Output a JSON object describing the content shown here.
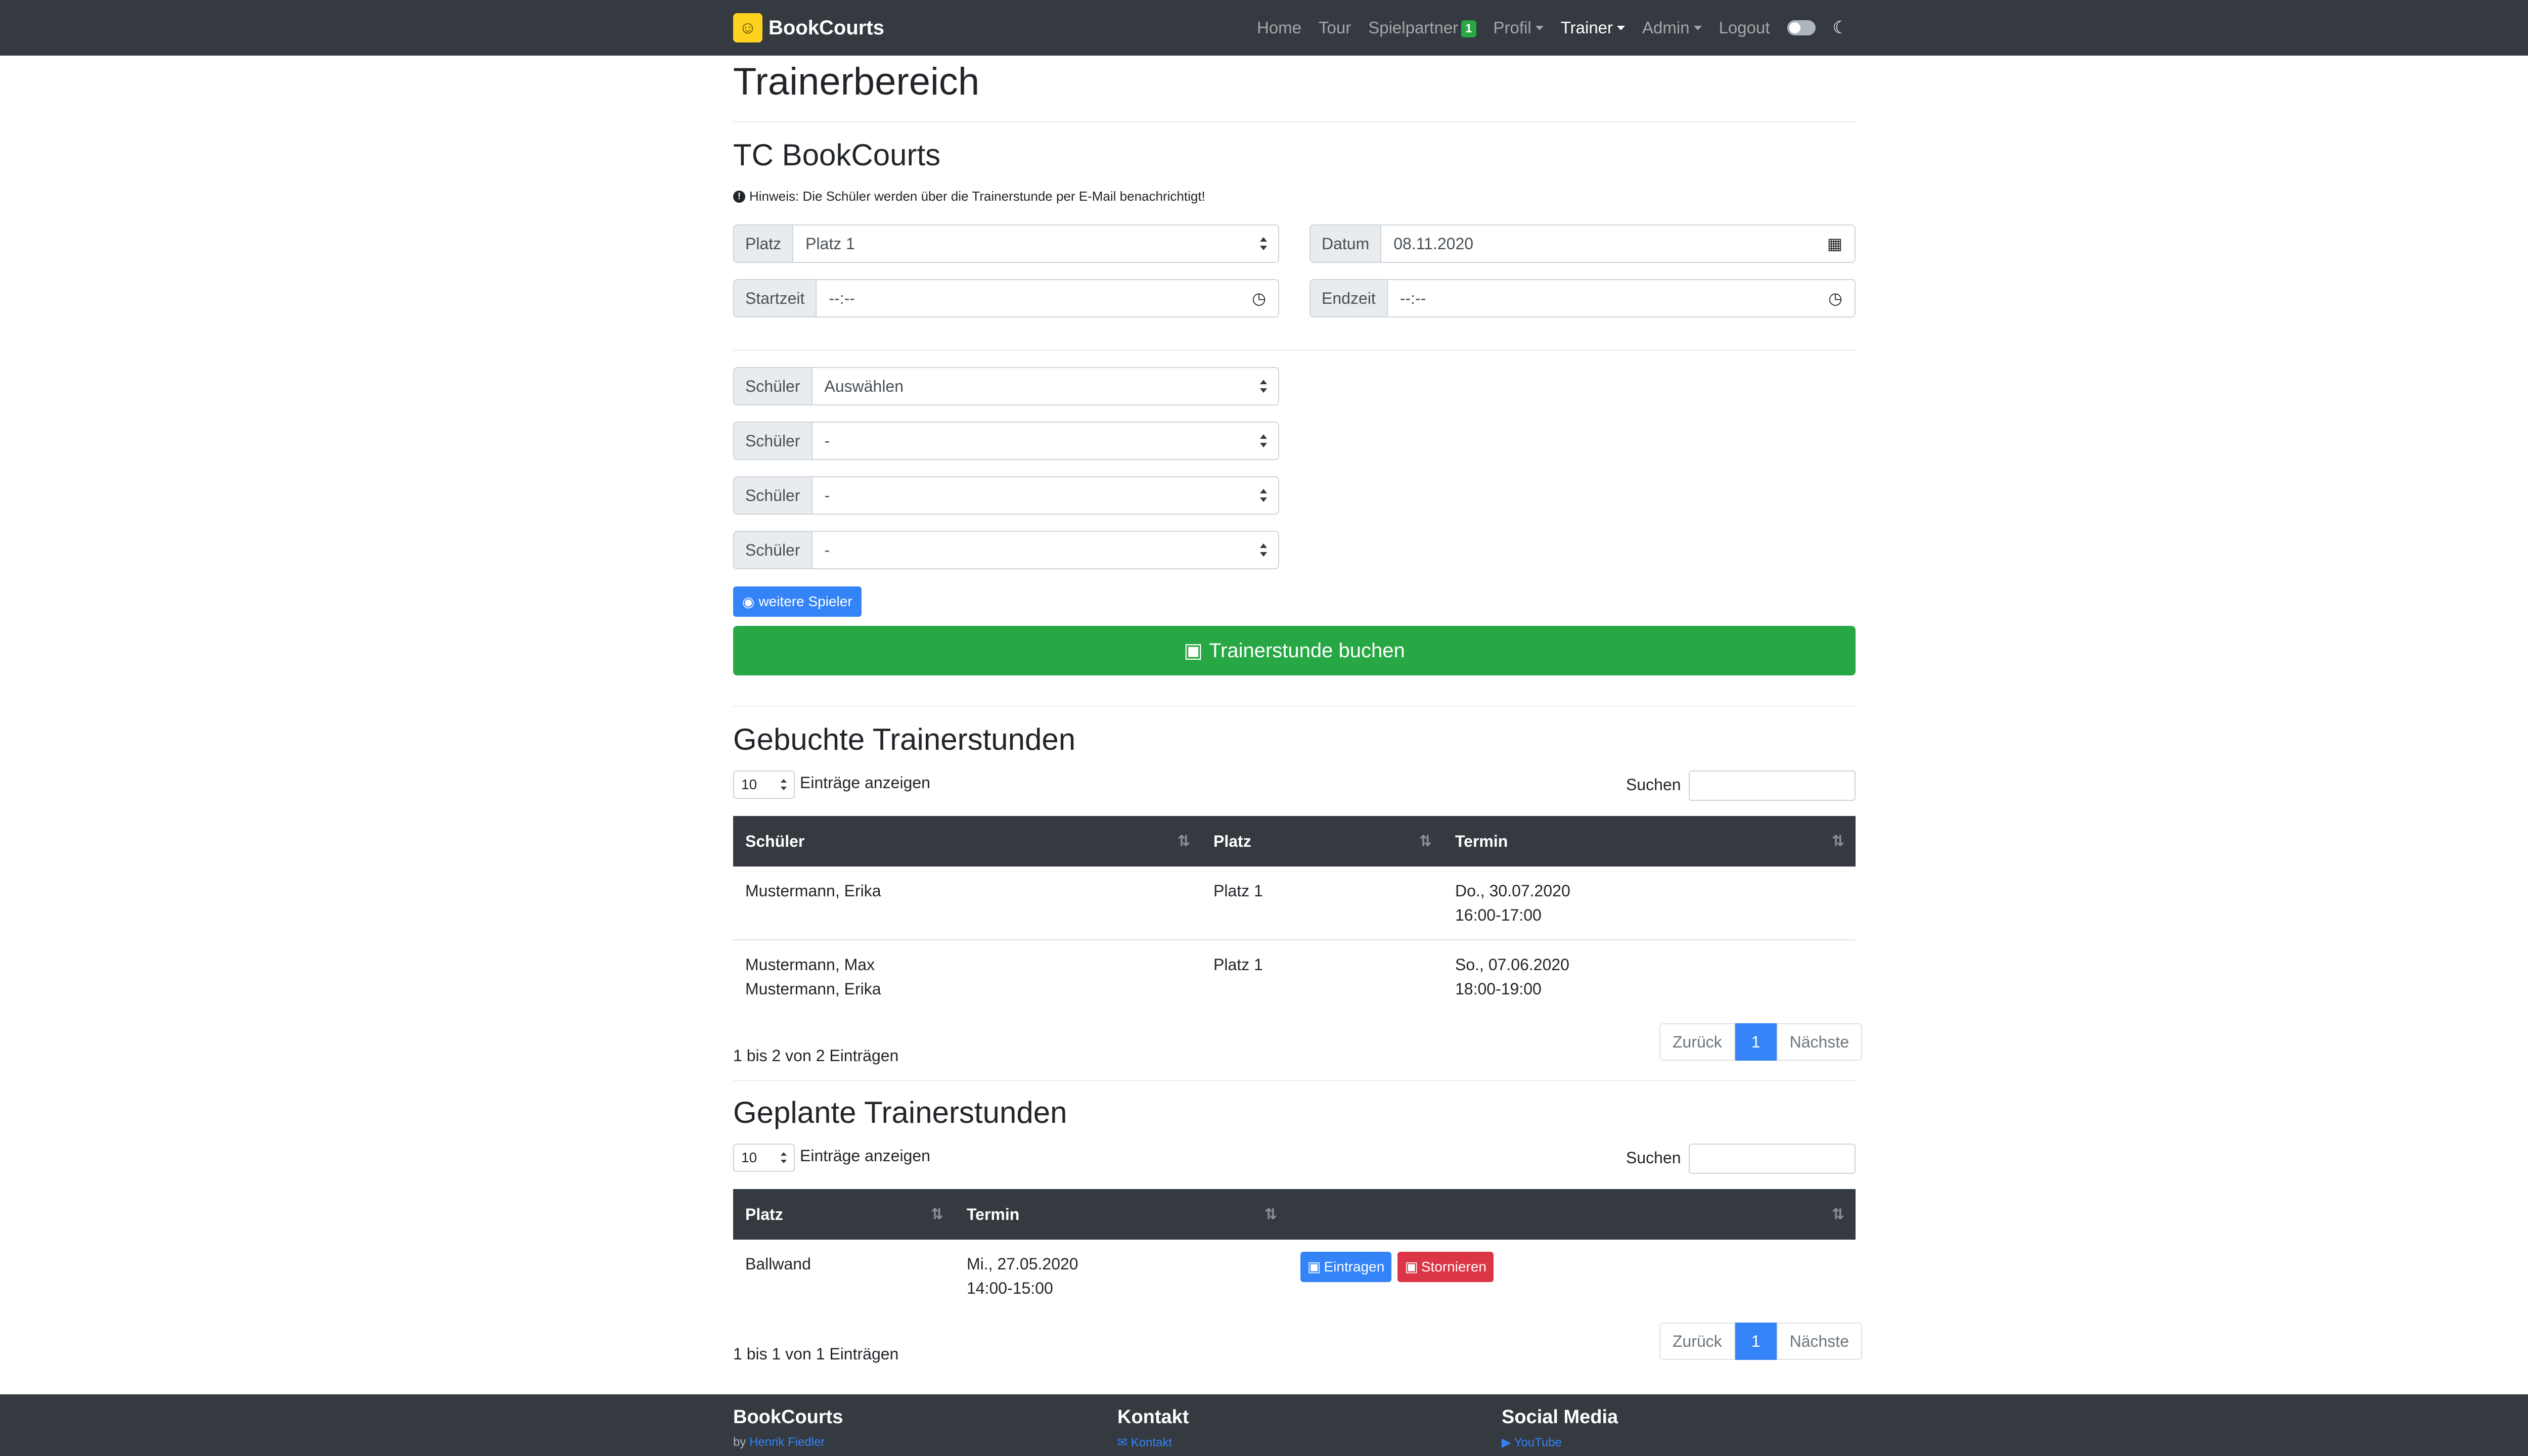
{
  "nav": {
    "brand": "BookCourts",
    "items": {
      "home": "Home",
      "tour": "Tour",
      "spielpartner": "Spielpartner",
      "spielpartner_badge": "1",
      "profil": "Profil",
      "trainer": "Trainer",
      "admin": "Admin",
      "logout": "Logout"
    }
  },
  "page": {
    "title": "Trainerbereich",
    "club": "TC BookCourts",
    "hint": "Hinweis: Die Schüler werden über die Trainerstunde per E-Mail benachrichtigt!"
  },
  "form": {
    "platz_label": "Platz",
    "platz_value": "Platz 1",
    "datum_label": "Datum",
    "datum_value": "08.11.2020",
    "startzeit_label": "Startzeit",
    "startzeit_value": "--:--",
    "endzeit_label": "Endzeit",
    "endzeit_value": "--:--",
    "schueler_label": "Schüler",
    "schueler_values": [
      "Auswählen",
      "-",
      "-",
      "-"
    ],
    "more_players": "weitere Spieler",
    "book_button": "Trainerstunde buchen"
  },
  "booked": {
    "title": "Gebuchte Trainerstunden",
    "length": "10",
    "length_label": "Einträge anzeigen",
    "search_label": "Suchen",
    "columns": [
      "Schüler",
      "Platz",
      "Termin"
    ],
    "rows": [
      {
        "schueler": [
          "Mustermann, Erika"
        ],
        "platz": "Platz 1",
        "termin": [
          "Do., 30.07.2020",
          "16:00-17:00"
        ]
      },
      {
        "schueler": [
          "Mustermann, Max",
          "Mustermann, Erika"
        ],
        "platz": "Platz 1",
        "termin": [
          "So., 07.06.2020",
          "18:00-19:00"
        ]
      }
    ],
    "info": "1 bis 2 von 2 Einträgen",
    "prev": "Zurück",
    "page": "1",
    "next": "Nächste"
  },
  "planned": {
    "title": "Geplante Trainerstunden",
    "length": "10",
    "length_label": "Einträge anzeigen",
    "search_label": "Suchen",
    "columns": [
      "Platz",
      "Termin",
      ""
    ],
    "rows": [
      {
        "platz": "Ballwand",
        "termin": [
          "Mi., 27.05.2020",
          "14:00-15:00"
        ],
        "enter_label": "Eintragen",
        "cancel_label": "Stornieren"
      }
    ],
    "info": "1 bis 1 von 1 Einträgen",
    "prev": "Zurück",
    "page": "1",
    "next": "Nächste"
  },
  "footer": {
    "brand": "BookCourts",
    "by_prefix": "by",
    "author": "Henrik Fiedler",
    "kontakt_title": "Kontakt",
    "kontakt_link": "Kontakt",
    "social_title": "Social Media",
    "youtube": "YouTube"
  },
  "colors": {
    "navbar": "#343a40",
    "primary": "#3483f7",
    "success": "#28a745",
    "danger": "#dc3545",
    "logo": "#ffd21f"
  },
  "icons": [
    "brand-logo-icon",
    "badge-icon",
    "info-icon",
    "calendar-icon",
    "clock-icon",
    "eye-icon",
    "calendar-plus-icon",
    "calendar-check-icon",
    "calendar-x-icon",
    "sort-icon",
    "moon-icon",
    "envelope-icon",
    "youtube-icon"
  ]
}
